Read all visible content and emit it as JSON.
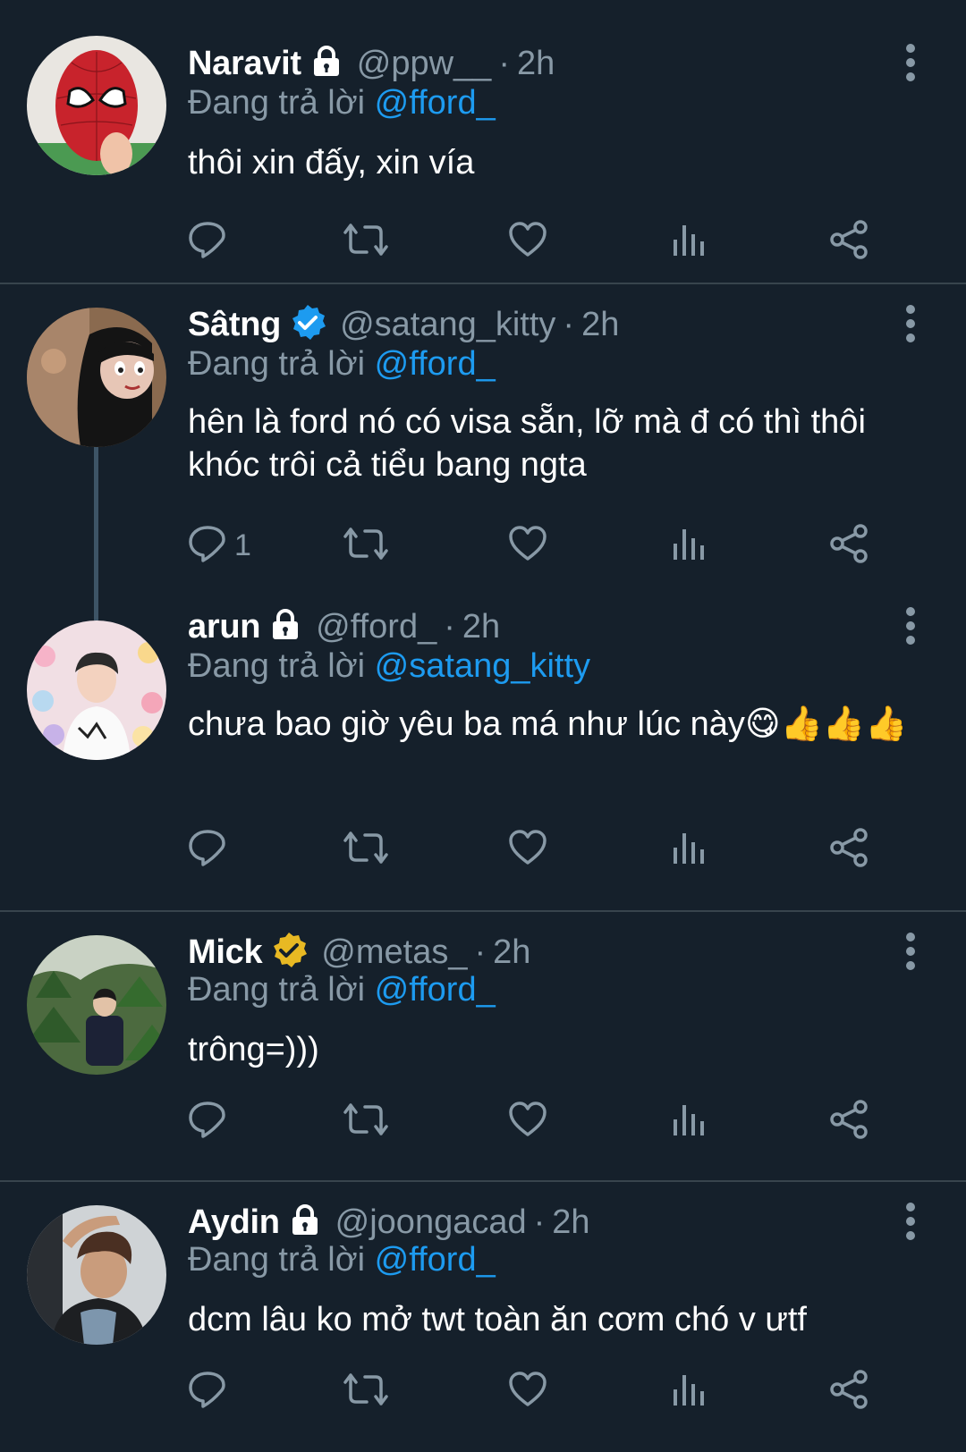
{
  "colors": {
    "background": "#15202b",
    "text": "#ffffff",
    "muted": "#8899a6",
    "link": "#1d9bf0",
    "separator": "#38444d",
    "verified_blue": "#1d9bf0",
    "verified_gold": "#e8b923"
  },
  "tweets": [
    {
      "name": "Naravit",
      "badge": "lock-icon",
      "handle": "@ppw__",
      "dot": "·",
      "time": "2h",
      "replying_label": "Đang trả lời",
      "mention": "@fford_",
      "text": "thôi xin đấy, xin vía",
      "reply_count": "",
      "avatar": "spiderman-mask-avatar"
    },
    {
      "name": "Sâtng",
      "badge": "verified-blue-icon",
      "handle": "@satang_kitty",
      "dot": "·",
      "time": "2h",
      "replying_label": "Đang trả lời",
      "mention": "@fford_",
      "text": "hên là ford nó có visa sẵn, lỡ mà đ có thì thôi khóc trôi cả tiểu bang ngta",
      "reply_count": "1",
      "avatar": "cartoon-vampire-girl-avatar"
    },
    {
      "name": "arun",
      "badge": "lock-icon",
      "handle": "@fford_",
      "dot": "·",
      "time": "2h",
      "replying_label": "Đang trả lời",
      "mention": "@satang_kitty",
      "text": "chưa bao giờ yêu ba má như lúc này",
      "emojis": "😋👍👍👍",
      "reply_count": "",
      "avatar": "person-with-plushies-avatar"
    },
    {
      "name": "Mick",
      "badge": "verified-gold-icon",
      "handle": "@metas_",
      "dot": "·",
      "time": "2h",
      "replying_label": "Đang trả lời",
      "mention": "@fford_",
      "text": "trông=)))",
      "reply_count": "",
      "avatar": "person-in-forest-avatar"
    },
    {
      "name": "Aydin",
      "badge": "lock-icon",
      "handle": "@joongacad",
      "dot": "·",
      "time": "2h",
      "replying_label": "Đang trả lời",
      "mention": "@fford_",
      "text": "dcm lâu ko mở twt toàn ăn cơm chó v ưtf",
      "reply_count": "",
      "avatar": "man-in-hoodie-avatar"
    }
  ],
  "action_icons": [
    "reply-icon",
    "retweet-icon",
    "like-icon",
    "views-icon",
    "share-icon"
  ]
}
